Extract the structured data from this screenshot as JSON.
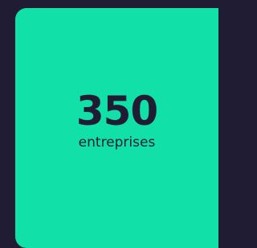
{
  "stat": {
    "value": "350",
    "label": "entreprises"
  },
  "colors": {
    "background": "#1f1c33",
    "card": "#11e0a8",
    "text": "#1f1c33"
  }
}
